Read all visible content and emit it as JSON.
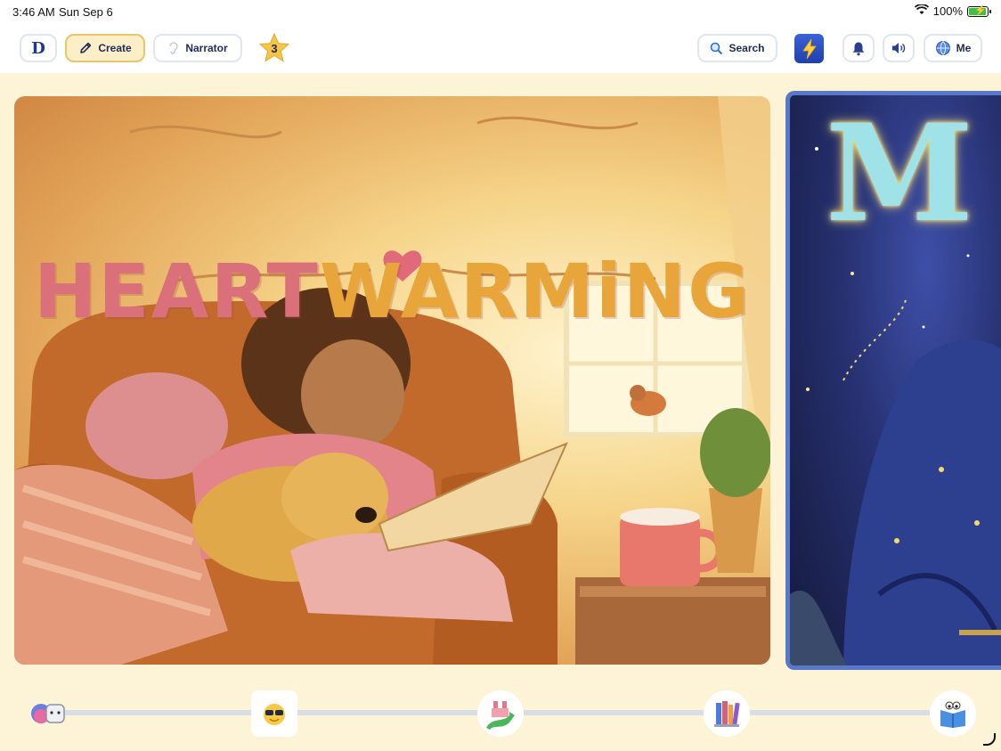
{
  "status_bar": {
    "time": "3:46 AM",
    "date": "Sun Sep 6",
    "battery": "100%",
    "battery_level": 1.0
  },
  "toolbar": {
    "logo": "D",
    "create_label": "Create",
    "narrator_label": "Narrator",
    "star_count": "3",
    "search_label": "Search",
    "me_label": "Me"
  },
  "cards": [
    {
      "title_part1": "HEART",
      "title_part2": "WARMiNG"
    },
    {
      "title_partial": "M"
    }
  ],
  "progress_nodes": [
    "friends-icon",
    "sunglasses-sun-icon",
    "castle-path-icon",
    "books-icon",
    "reader-icon"
  ],
  "colors": {
    "accent": "#e8c46a",
    "background": "#fdf3d7",
    "title_pink": "#d9707a",
    "title_gold": "#e7a53a"
  }
}
